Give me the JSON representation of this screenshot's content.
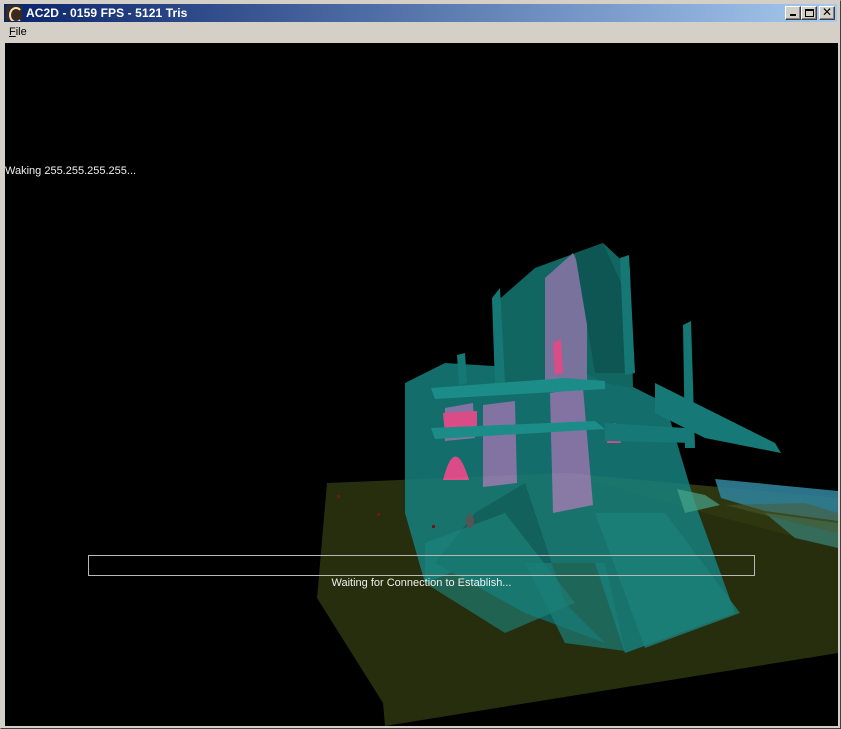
{
  "window": {
    "title": "AC2D - 0159 FPS - 5121 Tris",
    "icon": "ac2d-app-icon",
    "buttons": {
      "minimize": "minimize-icon",
      "maximize": "maximize-icon",
      "close": "close-icon"
    }
  },
  "menubar": {
    "items": [
      {
        "label": "File",
        "accelerator": "F",
        "rest": "ile"
      }
    ]
  },
  "viewport": {
    "background": "#000000",
    "status_top": "Waking 255.255.255.255...",
    "status_bottom": "Waiting for Connection to Establish...",
    "progress": 0,
    "colors": {
      "ground": "#2a3010",
      "building": "#1a8a8a",
      "window_glow": "#ff5aa0",
      "window_inner": "#9a88c0",
      "water": "#3a8aa0"
    }
  }
}
